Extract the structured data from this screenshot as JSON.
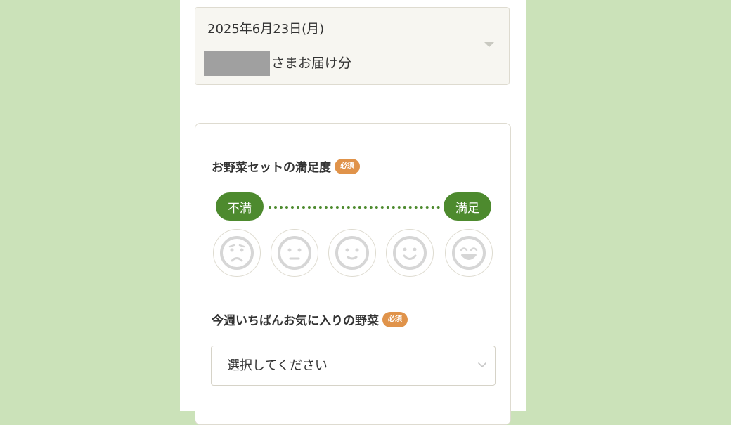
{
  "delivery": {
    "date": "2025年6月23日(月)",
    "recipient_suffix": "さまお届け分",
    "caret_icon": "caret-down-icon"
  },
  "survey": {
    "satisfaction": {
      "label": "お野菜セットの満足度",
      "required_badge": "必須",
      "scale_low": "不満",
      "scale_high": "満足",
      "faces": [
        "very-sad-face-icon",
        "neutral-face-icon",
        "slight-smile-face-icon",
        "smile-face-icon",
        "happy-face-icon"
      ]
    },
    "favorite_vegetable": {
      "label": "今週いちばんお気に入りの野菜",
      "required_badge": "必須",
      "placeholder": "選択してください",
      "chevron_icon": "chevron-down-icon"
    }
  },
  "colors": {
    "background": "#cbe2b9",
    "accent_green": "#4d8a2e",
    "badge_orange": "#e0934a",
    "panel_beige": "#f7f6f1"
  }
}
